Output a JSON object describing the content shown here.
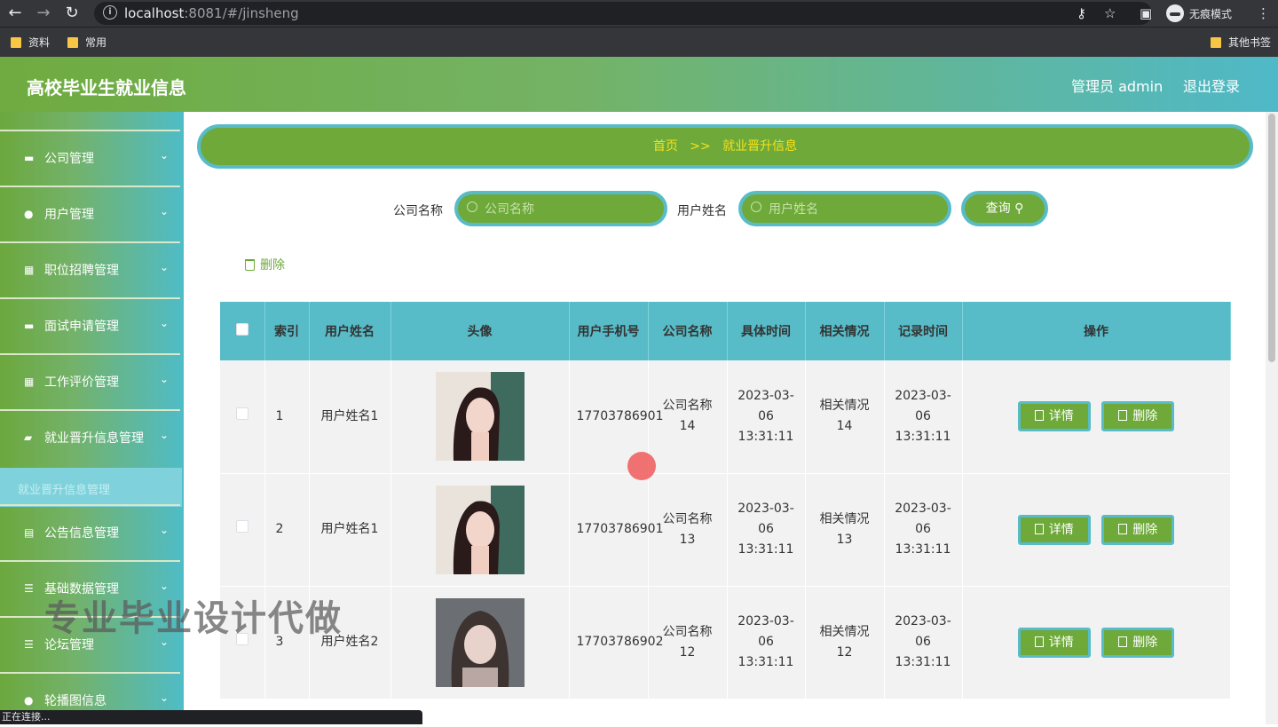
{
  "browser": {
    "url_host": "localhost",
    "url_rest": ":8081/#/jinsheng",
    "incognito_label": "无痕模式",
    "bookmarks": [
      "资料",
      "常用"
    ],
    "other_bookmarks": "其他书签",
    "status_text": "正在连接..."
  },
  "header": {
    "title": "高校毕业生就业信息",
    "admin_label": "管理员 admin",
    "logout_label": "退出登录"
  },
  "sidebar": {
    "items": [
      {
        "label": "公司管理",
        "icon": "building-icon"
      },
      {
        "label": "用户管理",
        "icon": "user-icon"
      },
      {
        "label": "职位招聘管理",
        "icon": "grid-icon"
      },
      {
        "label": "面试申请管理",
        "icon": "chat-icon"
      },
      {
        "label": "工作评价管理",
        "icon": "grid-icon"
      },
      {
        "label": "就业晋升信息管理",
        "icon": "briefcase-icon"
      },
      {
        "label": "公告信息管理",
        "icon": "notice-icon"
      },
      {
        "label": "基础数据管理",
        "icon": "list-icon"
      },
      {
        "label": "论坛管理",
        "icon": "list-icon"
      },
      {
        "label": "轮播图信息",
        "icon": "user-icon"
      }
    ],
    "active_submenu": "就业晋升信息管理"
  },
  "breadcrumb": {
    "home": "首页",
    "separator": ">>",
    "current": "就业晋升信息"
  },
  "search": {
    "company_label": "公司名称",
    "company_placeholder": "公司名称",
    "user_label": "用户姓名",
    "user_placeholder": "用户姓名",
    "query_label": "查询"
  },
  "toolbar": {
    "delete_label": "删除"
  },
  "table": {
    "headers": [
      "索引",
      "用户姓名",
      "头像",
      "用户手机号",
      "公司名称",
      "具体时间",
      "相关情况",
      "记录时间",
      "操作"
    ],
    "rows": [
      {
        "index": "1",
        "name": "用户姓名1",
        "phone": "17703786901",
        "company": "公司名称14",
        "time": "2023-03-06 13:31:11",
        "situation": "相关情况14",
        "record_time": "2023-03-06 13:31:11"
      },
      {
        "index": "2",
        "name": "用户姓名1",
        "phone": "17703786901",
        "company": "公司名称13",
        "time": "2023-03-06 13:31:11",
        "situation": "相关情况13",
        "record_time": "2023-03-06 13:31:11"
      },
      {
        "index": "3",
        "name": "用户姓名2",
        "phone": "17703786902",
        "company": "公司名称12",
        "time": "2023-03-06 13:31:11",
        "situation": "相关情况12",
        "record_time": "2023-03-06 13:31:11"
      }
    ],
    "detail_label": "详情",
    "delete_label": "删除"
  },
  "watermark": "专业毕业设计代做",
  "colors": {
    "primary_green": "#6ea93a",
    "border_cyan": "#58bcc8",
    "breadcrumb_text": "#f5e21a"
  }
}
